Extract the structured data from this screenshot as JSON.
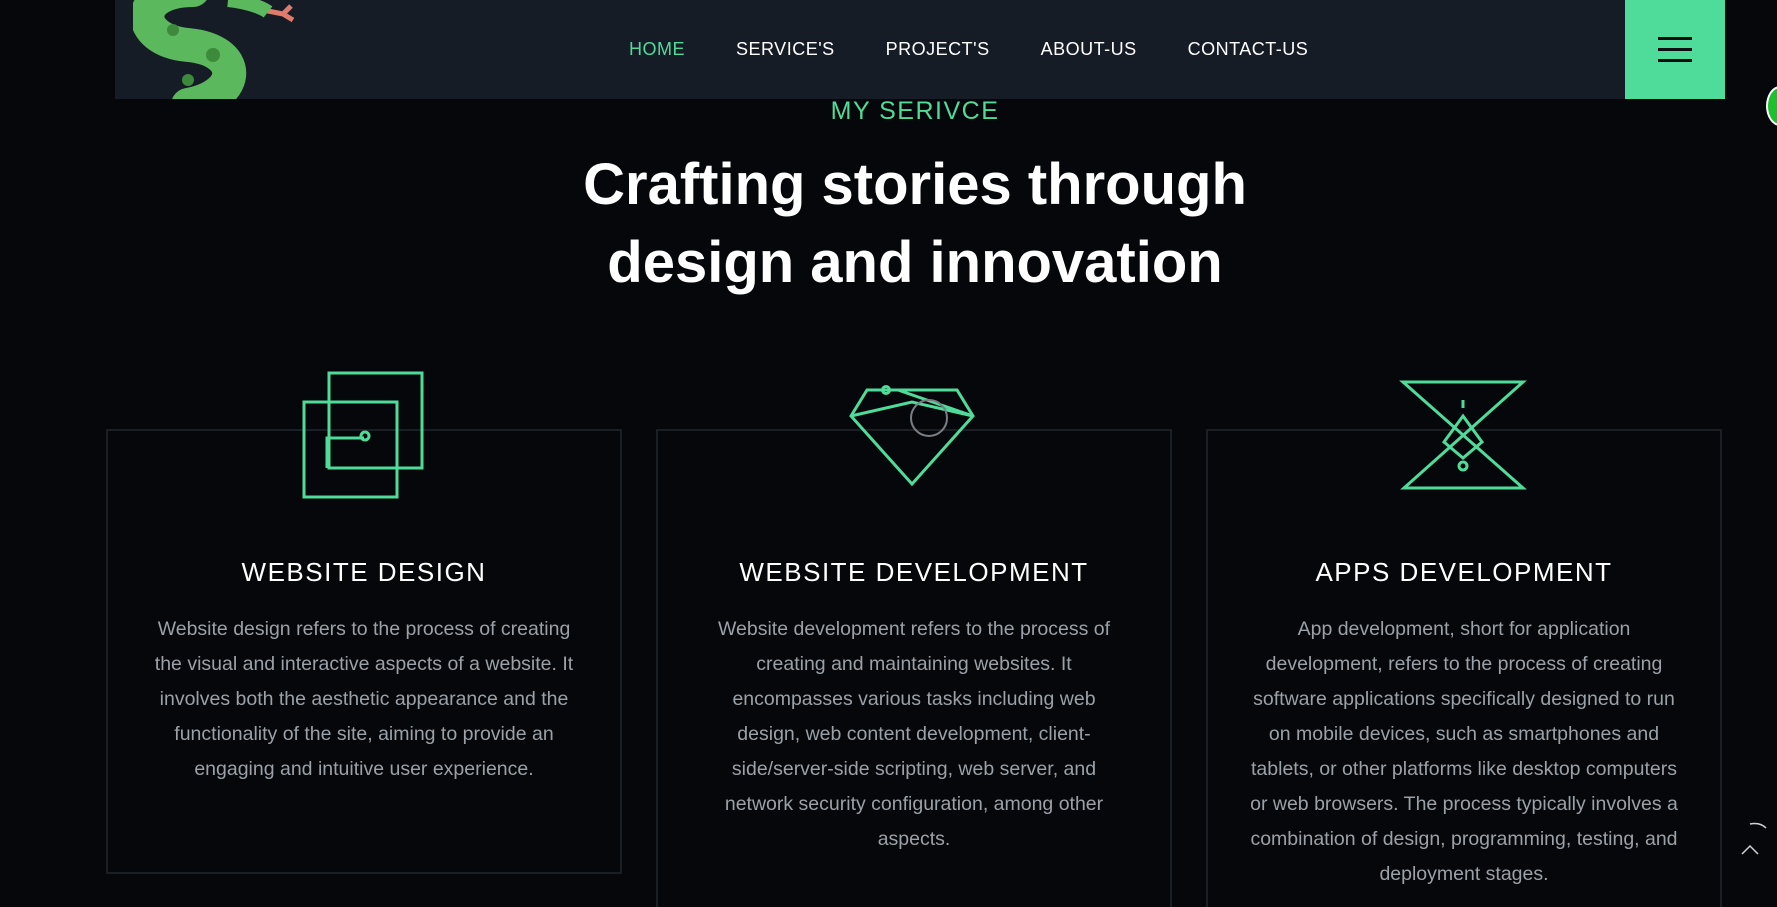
{
  "nav": {
    "items": [
      {
        "label": "HOME",
        "active": true
      },
      {
        "label": "SERVICE'S",
        "active": false
      },
      {
        "label": "PROJECT'S",
        "active": false
      },
      {
        "label": "ABOUT-US",
        "active": false
      },
      {
        "label": "CONTACT-US",
        "active": false
      }
    ],
    "menu_icon": "hamburger-icon"
  },
  "logo_icon": "snake-icon",
  "section": {
    "eyebrow": "MY SERIVCE",
    "headline_line1": "Crafting stories through",
    "headline_line2": "design and innovation"
  },
  "services": [
    {
      "icon": "overlapping-squares-icon",
      "title": "WEBSITE DESIGN",
      "text": "Website design refers to the process of creating the visual and interactive aspects of a website. It involves both the aesthetic appearance and the functionality of the site, aiming to provide an engaging and intuitive user experience."
    },
    {
      "icon": "diamond-icon",
      "title": "WEBSITE DEVELOPMENT",
      "text": "Website development refers to the process of creating and maintaining websites. It encompasses various tasks including web design, web content development, client-side/server-side scripting, web server, and network security configuration, among other aspects."
    },
    {
      "icon": "hourglass-icon",
      "title": "APPS DEVELOPMENT",
      "text": "App development, short for application development, refers to the process of creating software applications specifically designed to run on mobile devices, such as smartphones and tablets, or other platforms like desktop computers or web browsers. The process typically involves a combination of design, programming, testing, and deployment stages."
    }
  ],
  "colors": {
    "accent": "#4fdb9a",
    "background": "#05070a",
    "header": "#161c26",
    "card_border": "#1b1f24",
    "body_text": "#9ba1a8"
  }
}
